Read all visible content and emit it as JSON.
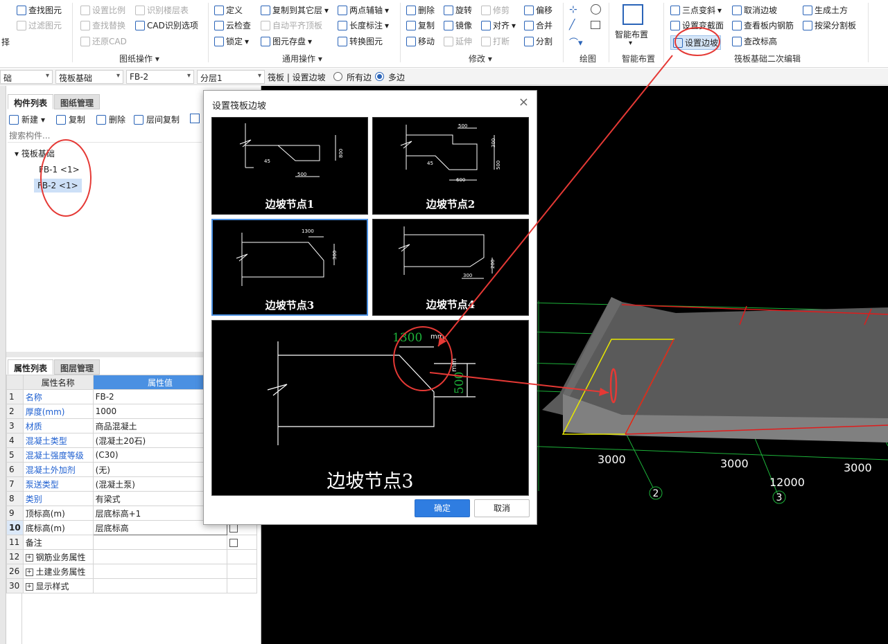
{
  "ribbon": {
    "col1": [
      "查找图元",
      "过滤图元"
    ],
    "col2": [
      "设置比例",
      "查找替换",
      "还原CAD"
    ],
    "col3": [
      "识别楼层表",
      "CAD识别选项"
    ],
    "group_cad": "图纸操作",
    "col4": [
      "定义",
      "云检查",
      "锁定"
    ],
    "col5": [
      "复制到其它层",
      "自动平齐顶板",
      "图元存盘"
    ],
    "col6": [
      "两点辅轴",
      "长度标注",
      "转换图元"
    ],
    "group_general": "通用操作",
    "col7": [
      "删除",
      "复制",
      "移动"
    ],
    "col8": [
      "旋转",
      "镜像",
      "延伸"
    ],
    "col9": [
      "修剪",
      "对齐",
      "打断"
    ],
    "col10": [
      "偏移",
      "合并",
      "分割"
    ],
    "group_modify": "修改",
    "group_draw": "绘图",
    "smart_layout": "智能布置",
    "group_smart": "智能布置",
    "col11": [
      "三点变斜",
      "设置变截面",
      "设置边坡"
    ],
    "col12": [
      "取消边坡",
      "查看板内钢筋",
      "查改标高"
    ],
    "col13": [
      "生成土方",
      "按梁分割板"
    ],
    "group_raft": "筏板基础二次编辑",
    "left_fragment": "择"
  },
  "toolbar2": {
    "sel0": "础",
    "sel1": "筏板基础",
    "sel2": "FB-2",
    "sel3": "分层1",
    "crumb": "筏板 | 设置边坡",
    "radio_all": "所有边",
    "radio_multi": "多边"
  },
  "panel": {
    "tab_components": "构件列表",
    "tab_drawings": "图纸管理",
    "new_label": "新建",
    "copy_label": "复制",
    "delete_label": "删除",
    "floor_copy_label": "层间复制",
    "search_placeholder": "搜索构件...",
    "tree_root": "筏板基础",
    "tree_items": [
      "FB-1 <1>",
      "FB-2 <1>"
    ],
    "tab_props": "属性列表",
    "tab_layers": "图层管理",
    "col_name": "属性名称",
    "col_value": "属性值",
    "rows": [
      {
        "n": "1",
        "name": "名称",
        "value": "FB-2"
      },
      {
        "n": "2",
        "name": "厚度(mm)",
        "value": "1000"
      },
      {
        "n": "3",
        "name": "材质",
        "value": "商品混凝土"
      },
      {
        "n": "4",
        "name": "混凝土类型",
        "value": "(混凝土20石)"
      },
      {
        "n": "5",
        "name": "混凝土强度等级",
        "value": "(C30)"
      },
      {
        "n": "6",
        "name": "混凝土外加剂",
        "value": "(无)"
      },
      {
        "n": "7",
        "name": "泵送类型",
        "value": "(混凝土泵)"
      },
      {
        "n": "8",
        "name": "类别",
        "value": "有梁式"
      },
      {
        "n": "9",
        "name": "顶标高(m)",
        "value": "层底标高+1"
      },
      {
        "n": "10",
        "name": "底标高(m)",
        "value": "层底标高"
      },
      {
        "n": "11",
        "name": "备注",
        "value": ""
      },
      {
        "n": "12",
        "name": "钢筋业务属性",
        "value": ""
      },
      {
        "n": "26",
        "name": "土建业务属性",
        "value": ""
      },
      {
        "n": "30",
        "name": "显示样式",
        "value": ""
      }
    ]
  },
  "viewport": {
    "dims": [
      "3000",
      "3000",
      "3000",
      "12000"
    ],
    "axis_labels": [
      "2",
      "3"
    ]
  },
  "dialog": {
    "title": "设置筏板边坡",
    "close": "×",
    "thumbs": [
      {
        "caption": "边坡节点1",
        "dims": [
          "800",
          "45",
          "500"
        ]
      },
      {
        "caption": "边坡节点2",
        "dims": [
          "500",
          "300",
          "45",
          "500",
          "600"
        ]
      },
      {
        "caption": "边坡节点3",
        "dims": [
          "1300",
          "300"
        ]
      },
      {
        "caption": "边坡节点4",
        "dims": [
          "200",
          "300"
        ]
      }
    ],
    "preview_caption": "边坡节点3",
    "preview_dim_h": "1300",
    "preview_dim_v": "500",
    "unit": "mm",
    "ok": "确定",
    "cancel": "取消"
  },
  "colors": {
    "accent": "#2f7de1",
    "annotation": "#e53935",
    "grid": "#1db33a",
    "slab_edge": "#e01b1b",
    "highlight": "#e8e800"
  }
}
